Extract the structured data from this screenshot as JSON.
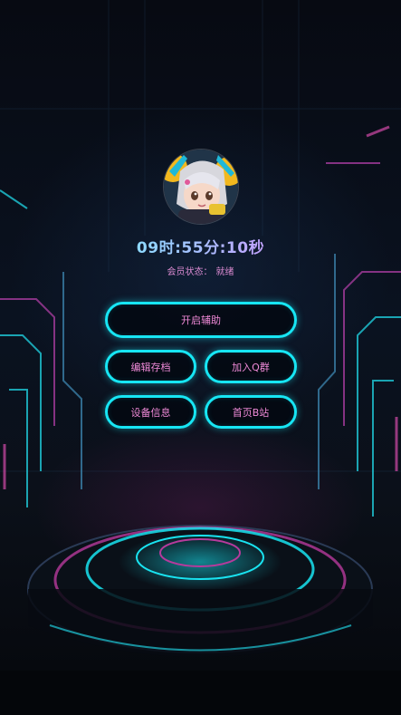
{
  "timer": {
    "hours": "09",
    "hours_unit": "时",
    "sep1": ":",
    "minutes": "55",
    "minutes_unit": "分",
    "sep2": ":",
    "seconds": "10",
    "seconds_unit": "秒"
  },
  "membership": {
    "label": "会员状态：",
    "value": "就绪"
  },
  "buttons": {
    "start_assist": "开启辅助",
    "edit_save": "编辑存档",
    "join_group": "加入Q群",
    "device_info": "设备信息",
    "homepage": "首页B站"
  },
  "colors": {
    "button_border": "#17e6f4",
    "button_text": "#f08ad8",
    "status_text": "#d98ad0",
    "background": "#05070d"
  },
  "icons": {
    "avatar": "anime-avatar"
  }
}
